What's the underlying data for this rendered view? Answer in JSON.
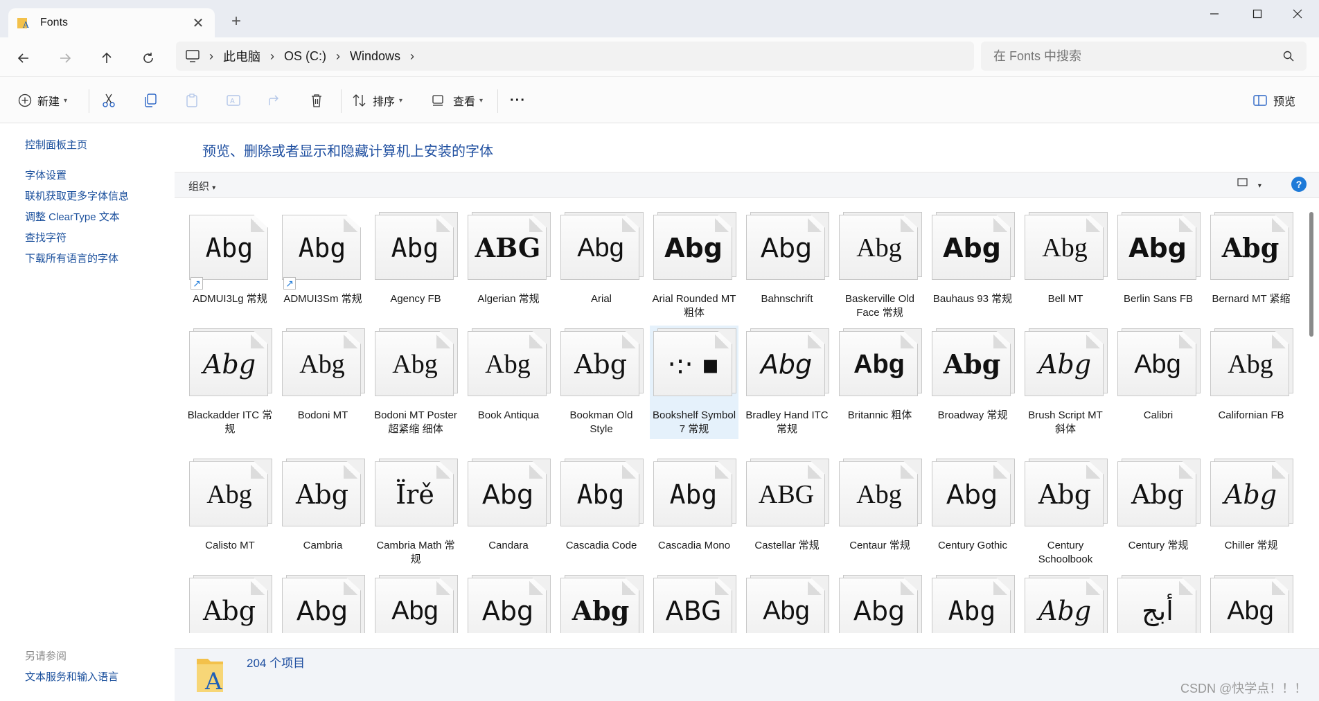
{
  "window": {
    "tab_title": "Fonts",
    "close_tab": "✕",
    "new_tab": "+"
  },
  "address": {
    "crumbs": [
      "此电脑",
      "OS (C:)",
      "Windows"
    ],
    "search_placeholder": "在 Fonts 中搜索"
  },
  "toolbar": {
    "new_label": "新建",
    "sort_label": "排序",
    "view_label": "查看",
    "more_label": "···",
    "preview_label": "预览"
  },
  "left_pane": {
    "home": "控制面板主页",
    "links": [
      "字体设置",
      "联机获取更多字体信息",
      "调整 ClearType 文本",
      "查找字符",
      "下载所有语言的字体"
    ],
    "see_also": "另请参阅",
    "see_also_links": [
      "文本服务和输入语言"
    ]
  },
  "main": {
    "heading": "预览、删除或者显示和隐藏计算机上安装的字体",
    "organize": "组织",
    "help": "?"
  },
  "fonts": [
    {
      "name": "ADMUI3Lg 常规",
      "sample": "Abg",
      "shortcut": true,
      "family": "\"DejaVu Sans Mono\", monospace"
    },
    {
      "name": "ADMUI3Sm 常规",
      "sample": "Abg",
      "shortcut": true,
      "family": "\"DejaVu Sans Mono\", monospace"
    },
    {
      "name": "Agency FB",
      "sample": "Abg",
      "family": "\"DejaVu Sans Mono\", monospace"
    },
    {
      "name": "Algerian 常规",
      "sample": "ABG",
      "family": "\"DejaVu Serif\", serif",
      "style": "bold"
    },
    {
      "name": "Arial",
      "sample": "Abg",
      "family": "\"Liberation Sans\", sans-serif"
    },
    {
      "name": "Arial Rounded MT 粗体",
      "sample": "Abg",
      "family": "\"DejaVu Sans\", sans-serif",
      "style": "bold"
    },
    {
      "name": "Bahnschrift",
      "sample": "Abg",
      "family": "\"DejaVu Sans\", sans-serif"
    },
    {
      "name": "Baskerville Old Face 常规",
      "sample": "Abg",
      "family": "\"Liberation Serif\", serif"
    },
    {
      "name": "Bauhaus 93 常规",
      "sample": "Abg",
      "family": "\"DejaVu Sans\", sans-serif",
      "style": "bold"
    },
    {
      "name": "Bell MT",
      "sample": "Abg",
      "family": "\"Liberation Serif\", serif"
    },
    {
      "name": "Berlin Sans FB",
      "sample": "Abg",
      "family": "\"DejaVu Sans\", sans-serif",
      "style": "bold"
    },
    {
      "name": "Bernard MT 紧缩",
      "sample": "Abg",
      "family": "\"DejaVu Serif\", serif",
      "style": "bold"
    },
    {
      "name": "Blackadder ITC 常规",
      "sample": "Abg",
      "family": "\"DejaVu Serif\", serif",
      "style": "italic"
    },
    {
      "name": "Bodoni MT",
      "sample": "Abg",
      "family": "\"Liberation Serif\", serif"
    },
    {
      "name": "Bodoni MT Poster 超紧缩 细体",
      "sample": "Abg",
      "family": "\"Liberation Serif\", serif"
    },
    {
      "name": "Book Antiqua",
      "sample": "Abg",
      "family": "\"Liberation Serif\", serif"
    },
    {
      "name": "Bookman Old Style",
      "sample": "Abg",
      "family": "\"DejaVu Serif\", serif"
    },
    {
      "name": "Bookshelf Symbol 7 常规",
      "sample": "·:·  ▪",
      "family": "\"DejaVu Sans\", sans-serif",
      "selected": true
    },
    {
      "name": "Bradley Hand ITC 常规",
      "sample": "Abg",
      "family": "\"DejaVu Sans\", sans-serif",
      "style": "italic"
    },
    {
      "name": "Britannic 粗体",
      "sample": "Abg",
      "family": "\"Liberation Sans\", sans-serif",
      "style": "bold"
    },
    {
      "name": "Broadway 常规",
      "sample": "Abg",
      "family": "\"DejaVu Serif\", serif",
      "style": "bold"
    },
    {
      "name": "Brush Script MT 斜体",
      "sample": "Abg",
      "family": "\"DejaVu Serif\", serif",
      "style": "italic"
    },
    {
      "name": "Calibri",
      "sample": "Abg",
      "family": "\"Liberation Sans\", sans-serif"
    },
    {
      "name": "Californian FB",
      "sample": "Abg",
      "family": "\"Liberation Serif\", serif"
    },
    {
      "name": "Calisto MT",
      "sample": "Abg",
      "family": "\"Liberation Serif\", serif"
    },
    {
      "name": "Cambria",
      "sample": "Abg",
      "family": "\"DejaVu Serif\", serif"
    },
    {
      "name": "Cambria Math 常规",
      "sample": "Ïrě",
      "family": "\"DejaVu Serif\", serif"
    },
    {
      "name": "Candara",
      "sample": "Abg",
      "family": "\"DejaVu Sans\", sans-serif"
    },
    {
      "name": "Cascadia Code",
      "sample": "Abg",
      "family": "\"DejaVu Sans Mono\", monospace"
    },
    {
      "name": "Cascadia Mono",
      "sample": "Abg",
      "family": "\"DejaVu Sans Mono\", monospace"
    },
    {
      "name": "Castellar 常规",
      "sample": "ABG",
      "family": "\"Liberation Serif\", serif"
    },
    {
      "name": "Centaur 常规",
      "sample": "Abg",
      "family": "\"Liberation Serif\", serif"
    },
    {
      "name": "Century Gothic",
      "sample": "Abg",
      "family": "\"DejaVu Sans\", sans-serif"
    },
    {
      "name": "Century Schoolbook",
      "sample": "Abg",
      "family": "\"DejaVu Serif\", serif"
    },
    {
      "name": "Century 常规",
      "sample": "Abg",
      "family": "\"DejaVu Serif\", serif"
    },
    {
      "name": "Chiller 常规",
      "sample": "Abg",
      "family": "\"DejaVu Serif\", serif",
      "style": "italic"
    },
    {
      "name": "",
      "sample": "Abg",
      "family": "\"DejaVu Serif\", serif"
    },
    {
      "name": "",
      "sample": "Abg",
      "family": "\"DejaVu Sans\", sans-serif"
    },
    {
      "name": "",
      "sample": "Abg",
      "family": "\"Liberation Sans\", sans-serif"
    },
    {
      "name": "",
      "sample": "Abg",
      "family": "\"DejaVu Sans\", sans-serif"
    },
    {
      "name": "",
      "sample": "Abg",
      "family": "\"DejaVu Serif\", serif",
      "style": "bold"
    },
    {
      "name": "",
      "sample": "ABG",
      "family": "\"DejaVu Sans\", sans-serif"
    },
    {
      "name": "",
      "sample": "Abg",
      "family": "\"Liberation Sans\", sans-serif"
    },
    {
      "name": "",
      "sample": "Abg",
      "family": "\"DejaVu Sans\", sans-serif"
    },
    {
      "name": "",
      "sample": "Abg",
      "family": "\"DejaVu Sans Mono\", monospace"
    },
    {
      "name": "",
      "sample": "Abg",
      "family": "\"DejaVu Serif\", serif",
      "style": "italic"
    },
    {
      "name": "",
      "sample": "أبج",
      "family": "\"DejaVu Sans\", sans-serif"
    },
    {
      "name": "",
      "sample": "Abg",
      "family": "\"Liberation Sans\", sans-serif"
    }
  ],
  "status": {
    "item_count": "204 个项目"
  },
  "watermark": "CSDN @快学点！！！",
  "colors": {
    "accent": "#1e7ad8",
    "link": "#1a4f9c",
    "heading": "#1f4fa0",
    "selection": "#e5f1fb"
  }
}
